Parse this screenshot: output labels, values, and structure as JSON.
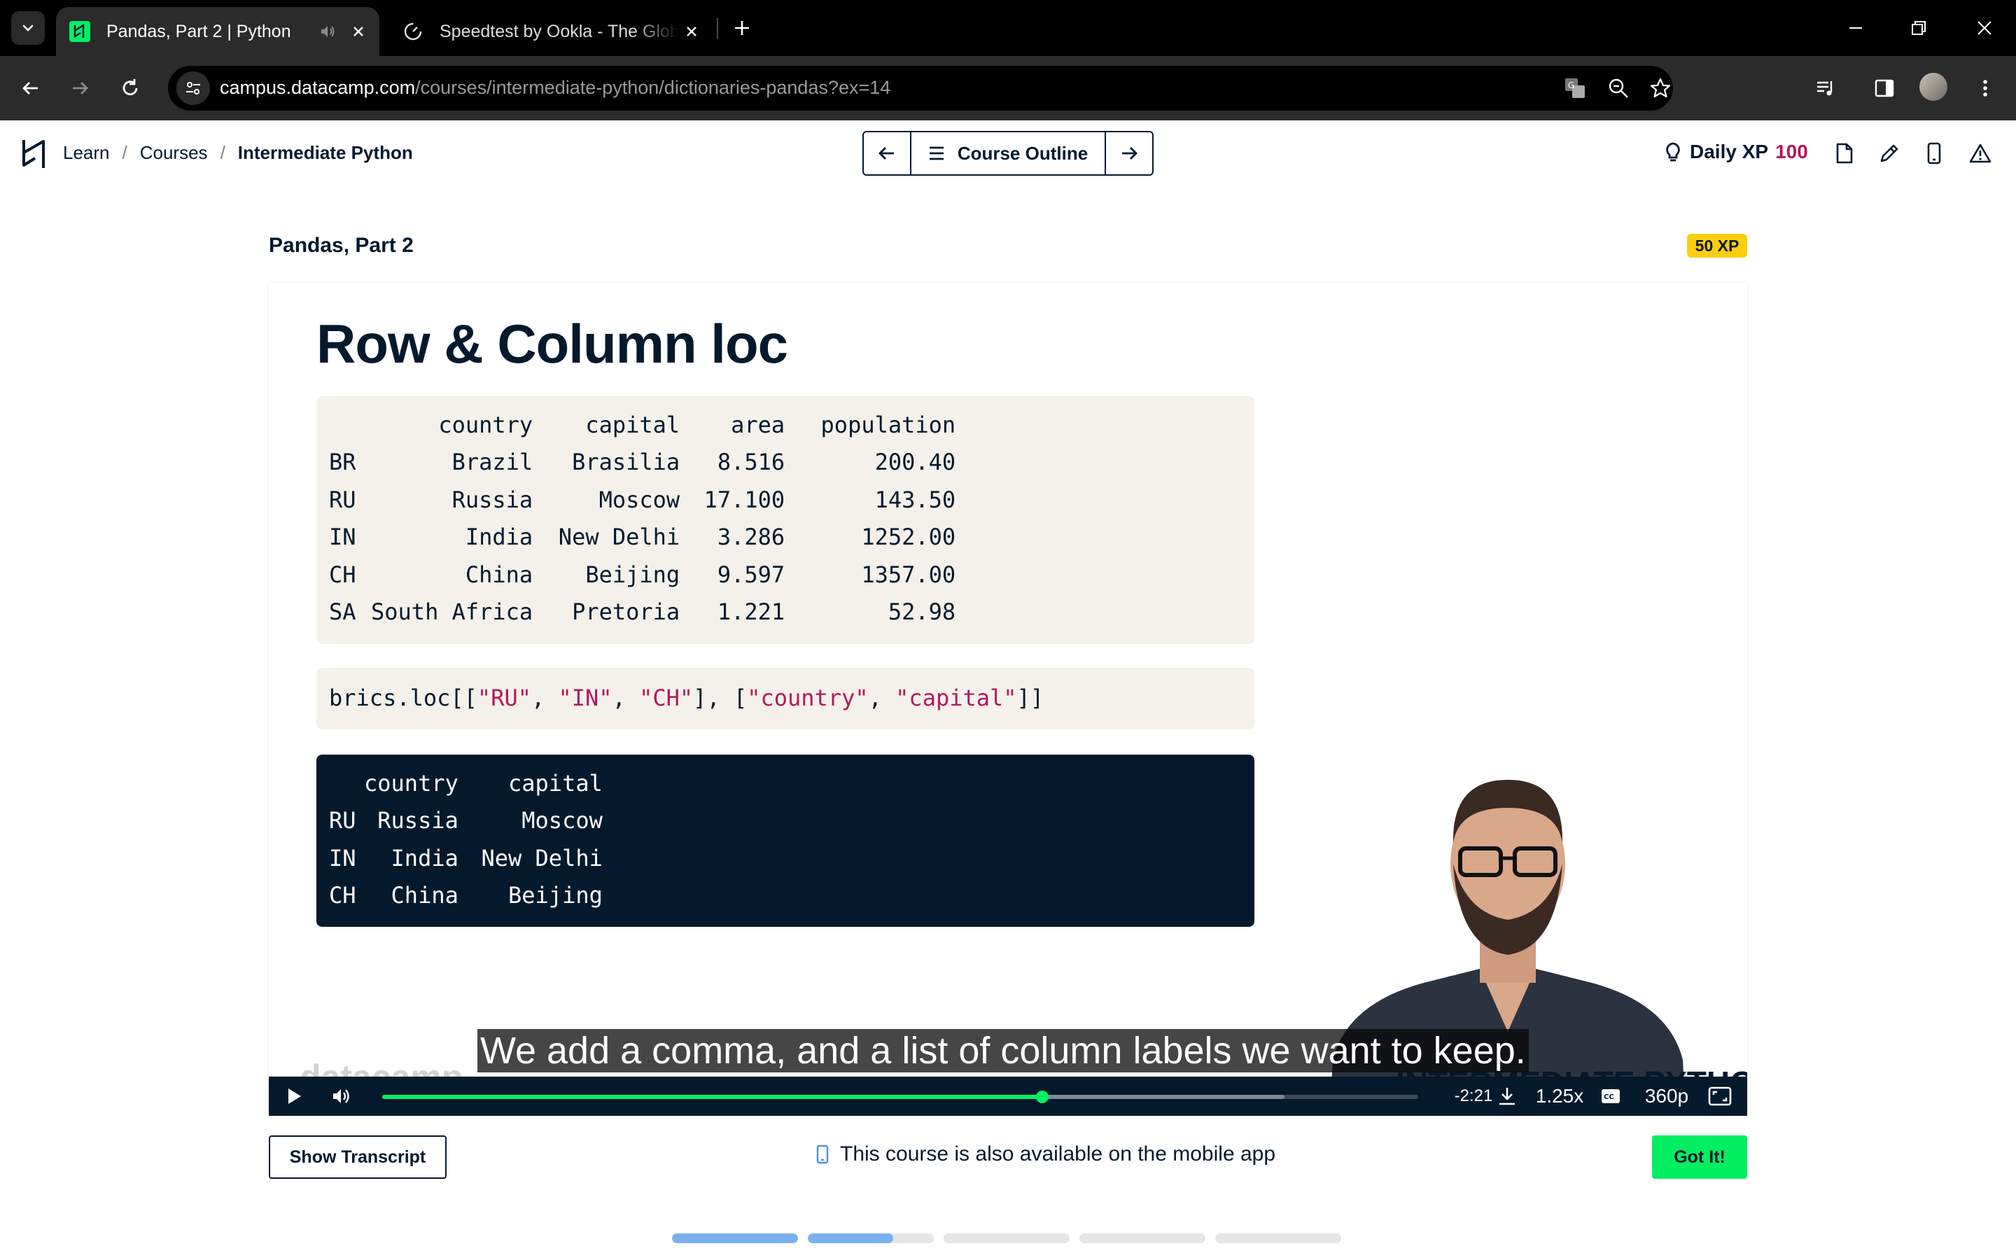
{
  "browser": {
    "tabs": [
      {
        "title": "Pandas, Part 2 | Python",
        "active": true
      },
      {
        "title": "Speedtest by Ookla - The Global Broadband Speed Test",
        "active": false
      }
    ],
    "url_host": "campus.datacamp.com",
    "url_path": "/courses/intermediate-python/dictionaries-pandas?ex=14"
  },
  "header": {
    "breadcrumb": {
      "learn": "Learn",
      "courses": "Courses",
      "current": "Intermediate Python"
    },
    "course_outline_label": "Course Outline",
    "daily_xp_label": "Daily XP",
    "daily_xp_value": "100"
  },
  "exercise": {
    "title": "Pandas, Part 2",
    "xp_badge": "50 XP"
  },
  "slide": {
    "title": "Row & Column loc",
    "dataframe": {
      "header": [
        "",
        "country",
        "capital",
        "area",
        "population"
      ],
      "rows": [
        [
          "BR",
          "Brazil",
          "Brasilia",
          "8.516",
          "200.40"
        ],
        [
          "RU",
          "Russia",
          "Moscow",
          "17.100",
          "143.50"
        ],
        [
          "IN",
          "India",
          "New Delhi",
          "3.286",
          "1252.00"
        ],
        [
          "CH",
          "China",
          "Beijing",
          "9.597",
          "1357.00"
        ],
        [
          "SA",
          "South Africa",
          "Pretoria",
          "1.221",
          "52.98"
        ]
      ]
    },
    "command": {
      "prefix": "brics.loc[[",
      "s1": "\"RU\"",
      "c1": ", ",
      "s2": "\"IN\"",
      "c2": ", ",
      "s3": "\"CH\"",
      "mid": "], [",
      "s4": "\"country\"",
      "c3": ", ",
      "s5": "\"capital\"",
      "suffix": "]]"
    },
    "output": {
      "header": [
        "",
        "country",
        "capital"
      ],
      "rows": [
        [
          "RU",
          "Russia",
          "Moscow"
        ],
        [
          "IN",
          "India",
          "New Delhi"
        ],
        [
          "CH",
          "China",
          "Beijing"
        ]
      ]
    },
    "watermark_course": "INTERMEDIATE PYTHON",
    "watermark_logo": "datacamp"
  },
  "video": {
    "caption": "We add a comma, and a list of column labels we want to keep.",
    "time_remaining": "-2:21",
    "speed": "1.25x",
    "quality": "360p",
    "progress_played": 0.637,
    "progress_buffered": 0.871
  },
  "footer": {
    "transcript_button": "Show Transcript",
    "mobile_note": "This course is also available on the mobile app",
    "got_it": "Got It!",
    "steps": [
      1.0,
      0.68,
      0,
      0,
      0
    ]
  },
  "colors": {
    "navy": "#05192d",
    "green": "#03ef62",
    "magenta": "#b5175b",
    "yellow": "#fcce0d",
    "code_bg": "#f4f1ea",
    "step_blue": "#7bb0ef"
  }
}
